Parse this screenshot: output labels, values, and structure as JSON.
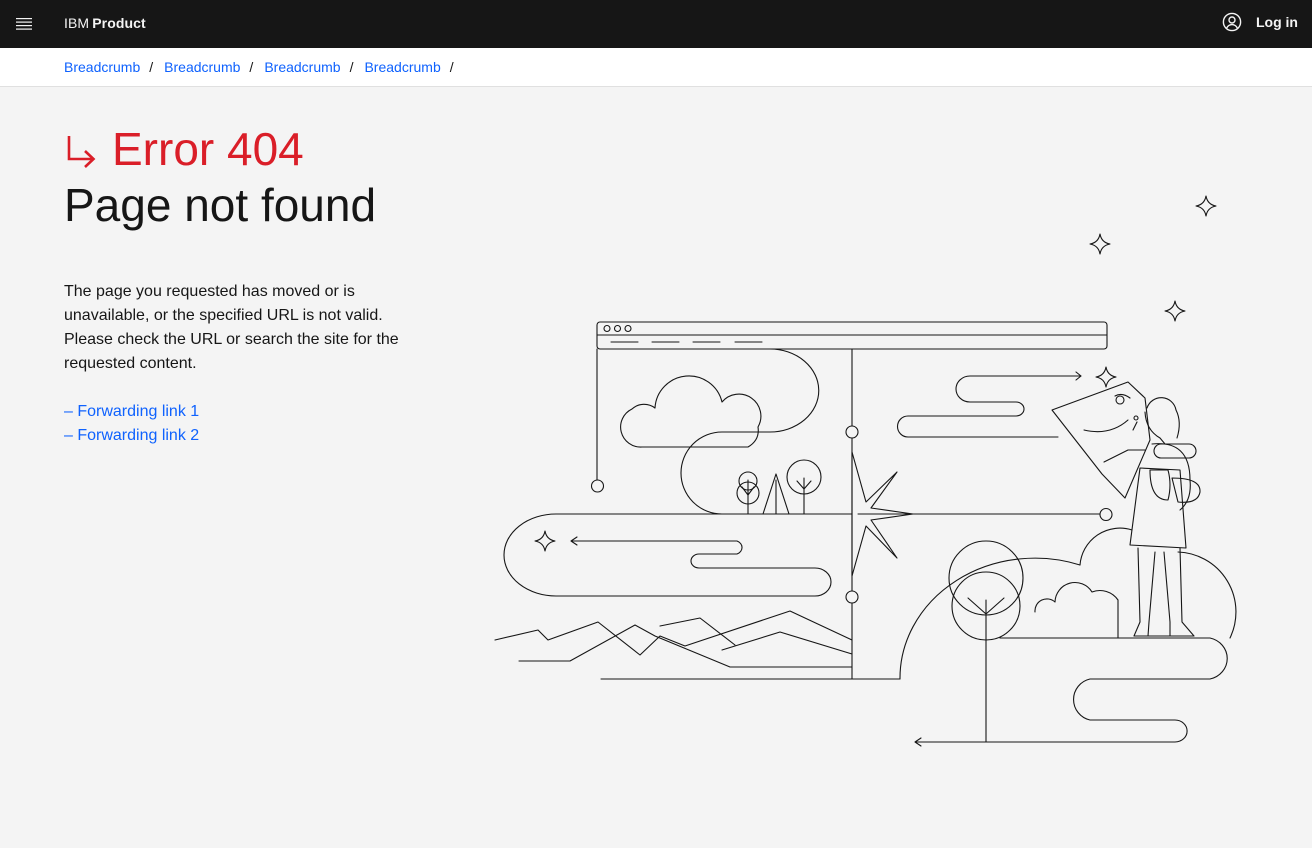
{
  "header": {
    "brand_prefix": "IBM",
    "brand_name": "Product",
    "login_label": "Log in",
    "menu_icon": "hamburger-menu-icon",
    "user_icon": "user-avatar-icon"
  },
  "breadcrumb": {
    "items": [
      "Breadcrumb",
      "Breadcrumb",
      "Breadcrumb",
      "Breadcrumb"
    ],
    "separator": "/"
  },
  "error": {
    "code_title": "Error 404",
    "page_title": "Page not found",
    "arrow_icon": "arrow-down-right-icon",
    "description": "The page you requested has moved or is unavailable, or the specified URL is not valid. Please check the URL or search the site for the requested content."
  },
  "links": [
    "– Forwarding link 1",
    "– Forwarding link 2"
  ],
  "colors": {
    "header_bg": "#161616",
    "page_bg": "#f4f4f4",
    "link": "#0f62fe",
    "error": "#da1e28"
  }
}
